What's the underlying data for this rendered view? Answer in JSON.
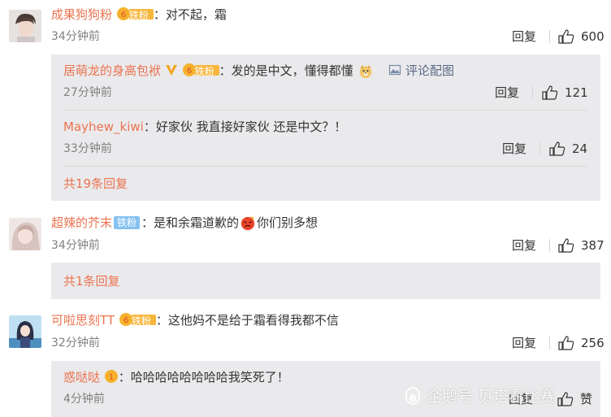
{
  "comments": [
    {
      "user": "成果狗狗粉",
      "badge": "铁粉",
      "text": "：对不起，霜",
      "time": "34分钟前",
      "reply_label": "回复",
      "likes": "600",
      "avatar_icon": "avatar-boy-photo"
    },
    {
      "user": "超辣的芥末",
      "badge": "铁粉",
      "text_before": "：是和余霜道歉的",
      "text_after": "你们别多想",
      "time": "34分钟前",
      "reply_label": "回复",
      "likes": "387",
      "more": "共1条回复",
      "avatar_icon": "avatar-girl-photo"
    },
    {
      "user": "可啦思刻TT",
      "badge": "铁粉",
      "text": "：这他妈不是给于霜看得我都不信",
      "time": "32分钟前",
      "reply_label": "回复",
      "likes": "256",
      "avatar_icon": "avatar-anime-girl"
    }
  ],
  "replies_1": [
    {
      "user": "居萌龙的身高包袱",
      "badge": "铁粉",
      "text": "：发的是中文，懂得都懂",
      "pic_label": "评论配图",
      "time": "27分钟前",
      "reply_label": "回复",
      "likes": "121"
    },
    {
      "user": "Mayhew_kiwi",
      "text": "：好家伙 我直接好家伙 还是中文？！",
      "time": "33分钟前",
      "reply_label": "回复",
      "likes": "24"
    }
  ],
  "replies_1_more": "共19条回复",
  "replies_3": [
    {
      "user": "惑哒哒",
      "text": "：哈哈哈哈哈哈哈哈我笑死了！",
      "time": "4分钟前",
      "reply_label": "回复",
      "likes": "赞"
    }
  ],
  "watermark": "企鹅号 贝塔看比赛",
  "colors": {
    "username": "#eb7350",
    "subbox": "#eaeaec",
    "time": "#808080"
  }
}
